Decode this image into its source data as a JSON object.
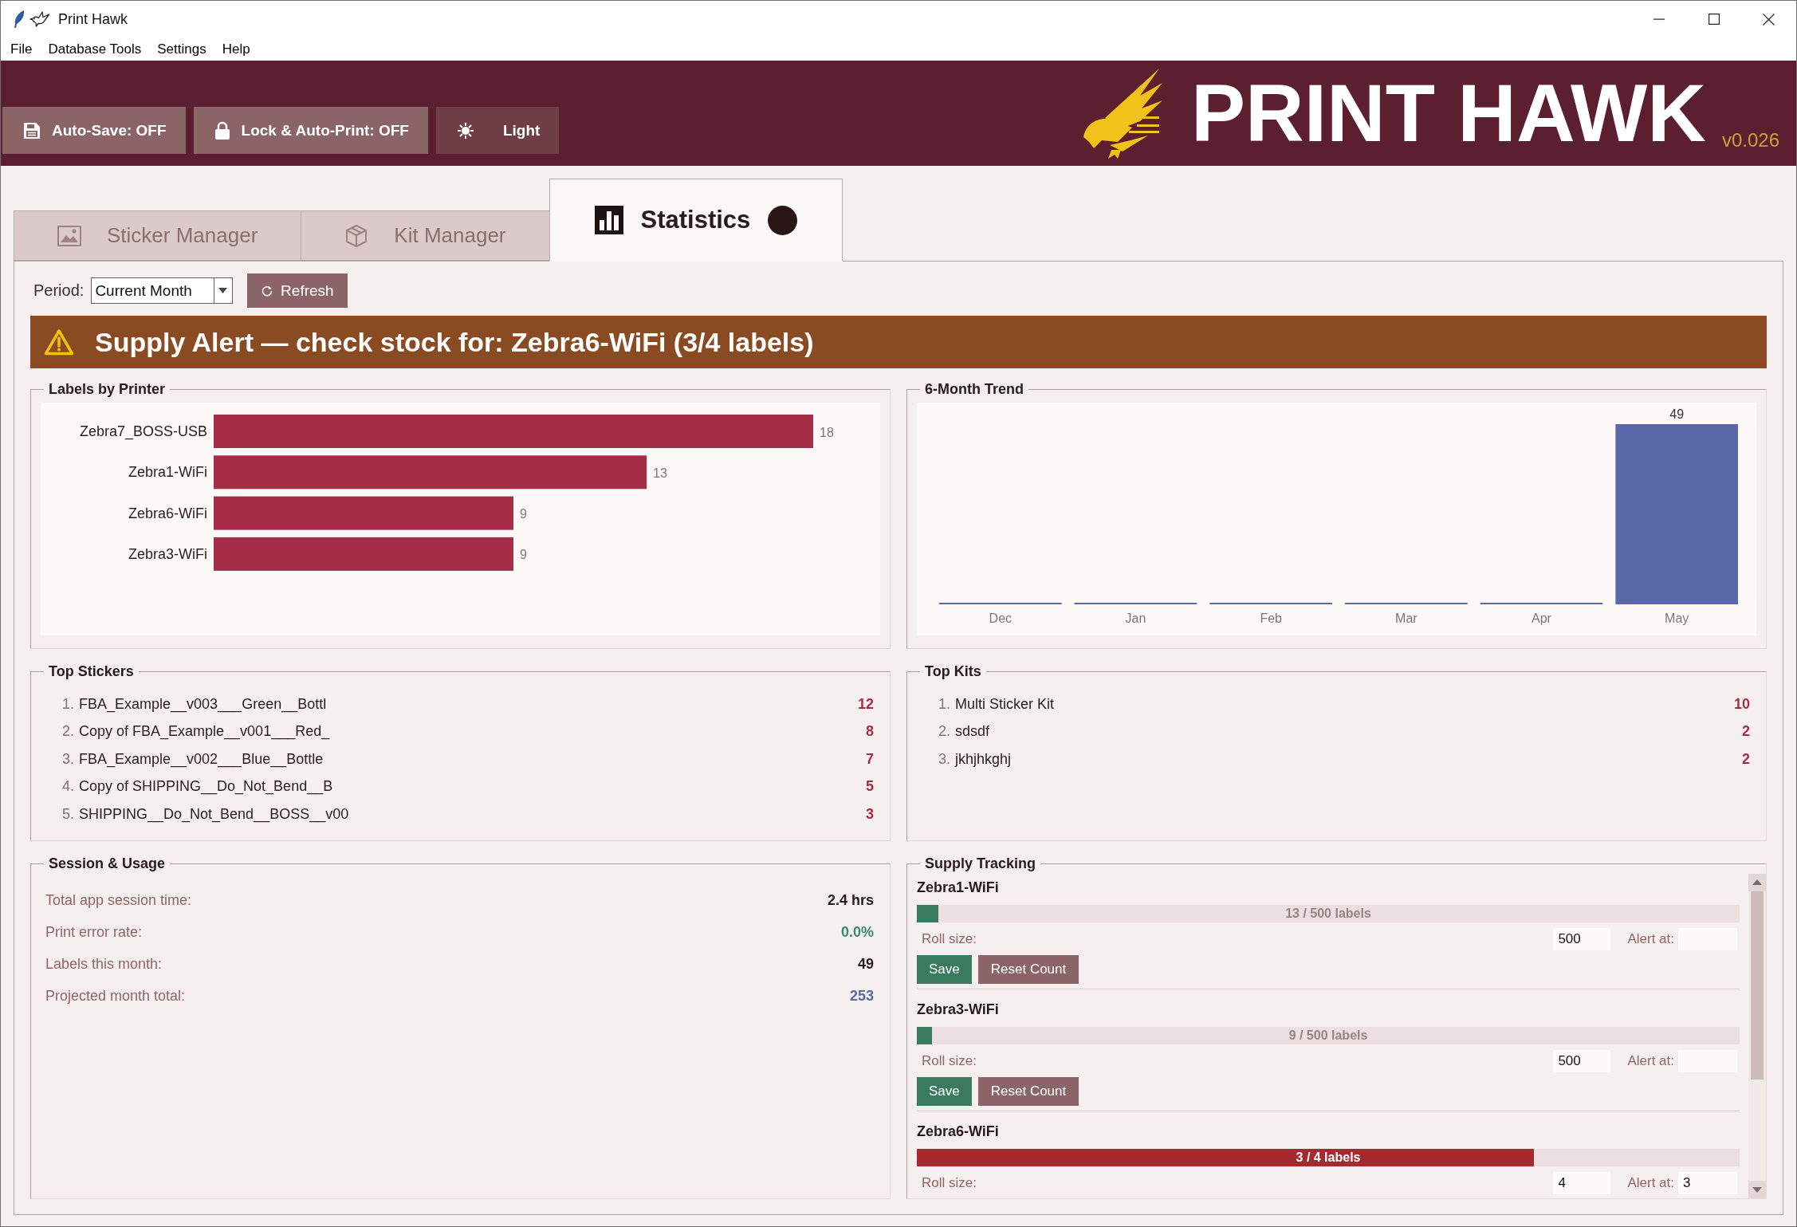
{
  "window": {
    "title": "Print Hawk"
  },
  "menu": [
    "File",
    "Database Tools",
    "Settings",
    "Help"
  ],
  "header": {
    "buttons": [
      {
        "label": "Auto-Save: OFF",
        "kind": "save"
      },
      {
        "label": "Lock & Auto-Print: OFF",
        "kind": "lock"
      },
      {
        "label": "Light",
        "kind": "theme"
      }
    ],
    "logo_text": "PRINT HAWK",
    "version": "v0.026"
  },
  "tabs": [
    {
      "label": "Sticker Manager",
      "selected": false,
      "alert_dot": false
    },
    {
      "label": "Kit Manager",
      "selected": false,
      "alert_dot": false
    },
    {
      "label": "Statistics",
      "selected": true,
      "alert_dot": true
    }
  ],
  "period": {
    "label": "Period:",
    "value": "Current Month"
  },
  "refresh_button": "Refresh",
  "alert_banner": "Supply Alert — check stock for: Zebra6-WiFi (3/4 labels)",
  "labels_by_printer": {
    "title": "Labels by Printer",
    "chart_data": {
      "type": "bar",
      "orientation": "horizontal",
      "categories": [
        "Zebra7_BOSS-USB",
        "Zebra1-WiFi",
        "Zebra6-WiFi",
        "Zebra3-WiFi"
      ],
      "values": [
        18,
        13,
        9,
        9
      ],
      "data_labels": true
    }
  },
  "trend": {
    "title": "6-Month Trend",
    "chart_data": {
      "type": "bar",
      "orientation": "vertical",
      "categories": [
        "Dec",
        "Jan",
        "Feb",
        "Mar",
        "Apr",
        "May"
      ],
      "values": [
        0,
        0,
        0,
        0,
        0,
        49
      ],
      "value_labels": [
        null,
        null,
        null,
        null,
        null,
        "49"
      ]
    }
  },
  "top_stickers": {
    "title": "Top Stickers",
    "items": [
      {
        "rank": "1.",
        "name": "FBA_Example__v003___Green__Bottl",
        "count": "12"
      },
      {
        "rank": "2.",
        "name": "Copy of FBA_Example__v001___Red_",
        "count": "8"
      },
      {
        "rank": "3.",
        "name": "FBA_Example__v002___Blue__Bottle",
        "count": "7"
      },
      {
        "rank": "4.",
        "name": "Copy of SHIPPING__Do_Not_Bend__B",
        "count": "5"
      },
      {
        "rank": "5.",
        "name": "SHIPPING__Do_Not_Bend__BOSS__v00",
        "count": "3"
      }
    ]
  },
  "top_kits": {
    "title": "Top Kits",
    "items": [
      {
        "rank": "1.",
        "name": "Multi Sticker Kit",
        "count": "10"
      },
      {
        "rank": "2.",
        "name": "sdsdf",
        "count": "2"
      },
      {
        "rank": "3.",
        "name": "jkhjhkghj",
        "count": "2"
      }
    ]
  },
  "session": {
    "title": "Session & Usage",
    "rows": [
      {
        "label": "Total app session time:",
        "value": "2.4 hrs",
        "color": "#2a1a1a"
      },
      {
        "label": "Print error rate:",
        "value": "0.0%",
        "color": "#3a8a68"
      },
      {
        "label": "Labels this month:",
        "value": "49",
        "color": "#2a1a1a"
      },
      {
        "label": "Projected month total:",
        "value": "253",
        "color": "#5a68a8"
      }
    ]
  },
  "supply": {
    "title": "Supply Tracking",
    "printers": [
      {
        "name": "Zebra1-WiFi",
        "level": 0.026,
        "alert": false,
        "progress_text": "13 / 500 labels",
        "roll_size_label": "Roll size:",
        "roll_size": "500",
        "alert_at_label": "Alert at:",
        "buttons": [
          {
            "label": "Save",
            "kind": "primary"
          },
          {
            "label": "Reset Count",
            "kind": "secondary"
          }
        ]
      },
      {
        "name": "Zebra3-WiFi",
        "level": 0.018,
        "alert": false,
        "progress_text": "9 / 500 labels",
        "roll_size_label": "Roll size:",
        "roll_size": "500",
        "alert_at_label": "Alert at:",
        "buttons": [
          {
            "label": "Save",
            "kind": "primary"
          },
          {
            "label": "Reset Count",
            "kind": "secondary"
          }
        ]
      },
      {
        "name": "Zebra6-WiFi",
        "level": 0.75,
        "alert": true,
        "progress_text": "3 / 4 labels",
        "roll_size_label": "Roll size:",
        "roll_size": "4",
        "alert_at_label": "Alert at:",
        "alert_at": "3"
      }
    ]
  }
}
